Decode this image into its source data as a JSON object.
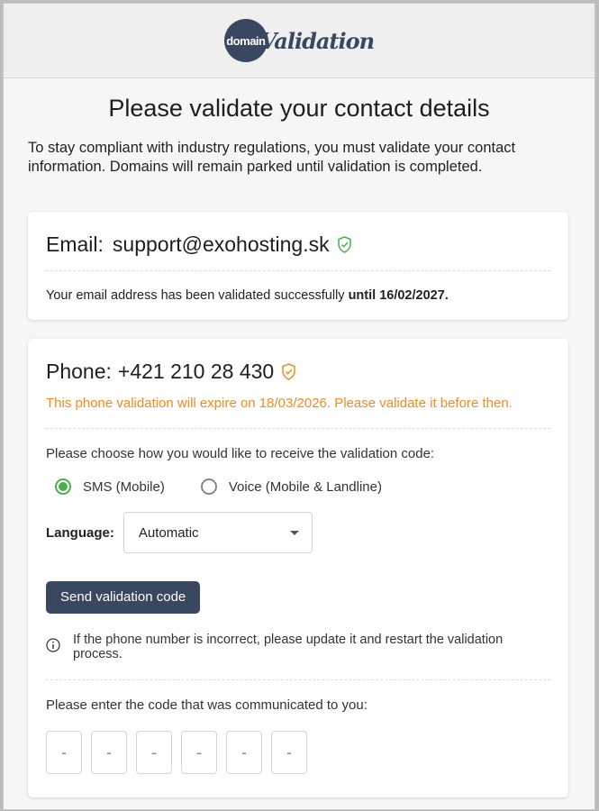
{
  "brand": {
    "logo_circle_text": "domain",
    "logo_script_text": "Validation"
  },
  "page": {
    "title": "Please validate your contact details",
    "intro": "To stay compliant with industry regulations, you must validate your contact information. Domains will remain parked until validation is completed."
  },
  "email": {
    "label": "Email:",
    "address": "support@exohosting.sk",
    "status_prefix": "Your email address has been validated successfully",
    "status_until": "until 16/02/2027.",
    "shield_color": "#4caf50"
  },
  "phone": {
    "label": "Phone:",
    "number": "+421 210 28 430",
    "shield_color": "#f08a24",
    "warning": "This phone validation will expire on 18/03/2026. Please validate it before then.",
    "choose_label": "Please choose how you would like to receive the validation code:",
    "options": [
      {
        "label": "SMS (Mobile)",
        "selected": true
      },
      {
        "label": "Voice (Mobile & Landline)",
        "selected": false
      }
    ],
    "language_label": "Language:",
    "language_value": "Automatic",
    "send_button": "Send validation code",
    "info_text": "If the phone number is incorrect, please update it and restart the validation process.",
    "code_prompt": "Please enter the code that was communicated to you:",
    "code_placeholder": "-"
  },
  "colors": {
    "accent": "#3a4760",
    "success": "#4caf50",
    "warning": "#f08a24"
  }
}
